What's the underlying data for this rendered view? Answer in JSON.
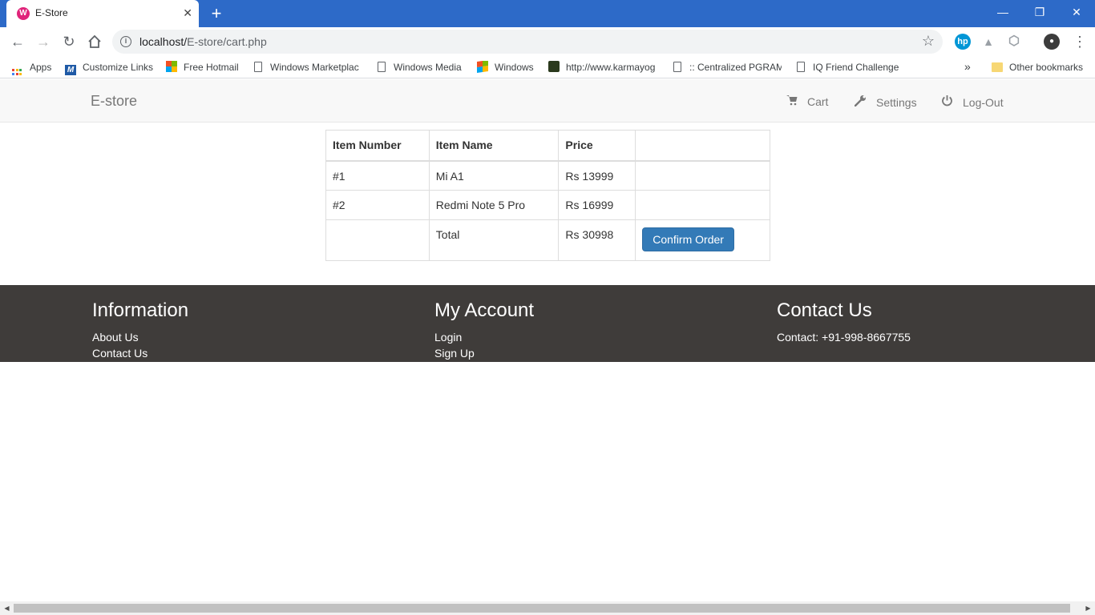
{
  "browser": {
    "tab_title": "E-Store",
    "tab_favicon_letter": "W",
    "url_host": "localhost/",
    "url_path": "E-store/cart.php",
    "bookmarks": [
      {
        "label": "Apps",
        "icon": "apps-grid-icon"
      },
      {
        "label": "Customize Links",
        "icon": "msn-m-icon"
      },
      {
        "label": "Free Hotmail",
        "icon": "windows-flag-icon"
      },
      {
        "label": "Windows Marketplac",
        "icon": "page-icon"
      },
      {
        "label": "Windows Media",
        "icon": "page-icon"
      },
      {
        "label": "Windows",
        "icon": "windows-flag-icon"
      },
      {
        "label": "http://www.karmayog",
        "icon": "site-icon"
      },
      {
        "label": ":: Centralized PGRAM",
        "icon": "page-icon"
      },
      {
        "label": "IQ Friend Challenge",
        "icon": "page-icon"
      }
    ],
    "more_bookmarks": "»",
    "other_bookmarks": "Other bookmarks"
  },
  "site": {
    "brand": "E-store",
    "nav": {
      "cart": "Cart",
      "settings": "Settings",
      "logout": "Log-Out"
    }
  },
  "cart": {
    "headers": [
      "Item Number",
      "Item Name",
      "Price",
      ""
    ],
    "rows": [
      {
        "number": "#1",
        "name": "Mi A1",
        "price": "Rs 13999"
      },
      {
        "number": "#2",
        "name": "Redmi Note 5 Pro",
        "price": "Rs 16999"
      }
    ],
    "total_label": "Total",
    "total_price": "Rs 30998",
    "confirm_label": "Confirm Order"
  },
  "footer": {
    "information": {
      "title": "Information",
      "links": [
        "About Us",
        "Contact Us"
      ]
    },
    "account": {
      "title": "My Account",
      "links": [
        "Login",
        "Sign Up"
      ]
    },
    "contact": {
      "title": "Contact Us",
      "text": "Contact: +91-998-8667755"
    }
  },
  "colors": {
    "chrome_blue": "#2d6ac8",
    "primary_button": "#337ab7",
    "footer_bg": "#3f3c3a"
  }
}
